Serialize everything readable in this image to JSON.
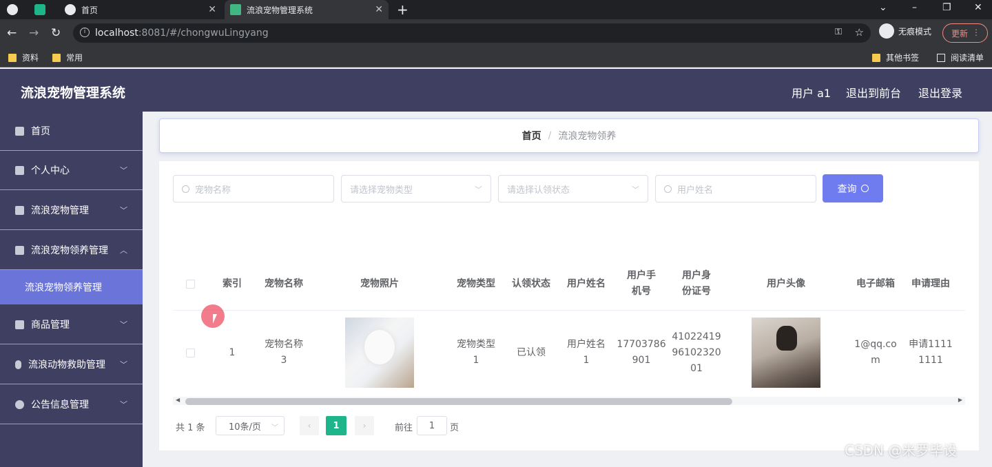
{
  "browser": {
    "tabs": [
      {
        "label": ""
      },
      {
        "label": ""
      },
      {
        "label": "首页"
      },
      {
        "label": "流浪宠物管理系统"
      }
    ],
    "url_host": "localhost",
    "url_rest": ":8081/#/chongwuLingyang",
    "incognito_label": "无痕模式",
    "update_label": "更新",
    "bookmarks": [
      "资料",
      "常用"
    ],
    "bookmarks_right": [
      "其他书签",
      "阅读清单"
    ]
  },
  "header": {
    "title": "流浪宠物管理系统",
    "user": "用户 a1",
    "back_to_front": "退出到前台",
    "logout": "退出登录"
  },
  "sidebar": {
    "items": [
      {
        "label": "首页"
      },
      {
        "label": "个人中心"
      },
      {
        "label": "流浪宠物管理"
      },
      {
        "label": "流浪宠物领养管理"
      },
      {
        "label": "商品管理"
      },
      {
        "label": "流浪动物救助管理"
      },
      {
        "label": "公告信息管理"
      }
    ],
    "active_sub": "流浪宠物领养管理"
  },
  "breadcrumb": {
    "home": "首页",
    "current": "流浪宠物领养"
  },
  "search": {
    "pet_name_placeholder": "宠物名称",
    "pet_type_placeholder": "请选择宠物类型",
    "status_placeholder": "请选择认领状态",
    "user_name_placeholder": "用户姓名",
    "query_label": "查询"
  },
  "table": {
    "headers": [
      "索引",
      "宠物名称",
      "宠物照片",
      "宠物类型",
      "认领状态",
      "用户姓名",
      "用户手机号",
      "用户身份证号",
      "用户头像",
      "电子邮箱",
      "申请理由"
    ],
    "rows": [
      {
        "index": "1",
        "pet_name": "宠物名称3",
        "pet_type": "宠物类型1",
        "status": "已认领",
        "user_name": "用户姓名1",
        "phone": "17703786901",
        "id_card": "410224199610232001",
        "email": "1@qq.com",
        "reason": "申请11111111"
      }
    ]
  },
  "pager": {
    "total": "共 1 条",
    "page_size": "10条/页",
    "current": "1",
    "goto_label": "前往",
    "goto_value": "1",
    "page_label": "页"
  },
  "watermark": "CSDN @米罗毕设",
  "colors": {
    "header": "#3f3f62",
    "accent": "#6f7cf0",
    "active_menu": "#6b74d9",
    "pager_active": "#1fb58a"
  }
}
